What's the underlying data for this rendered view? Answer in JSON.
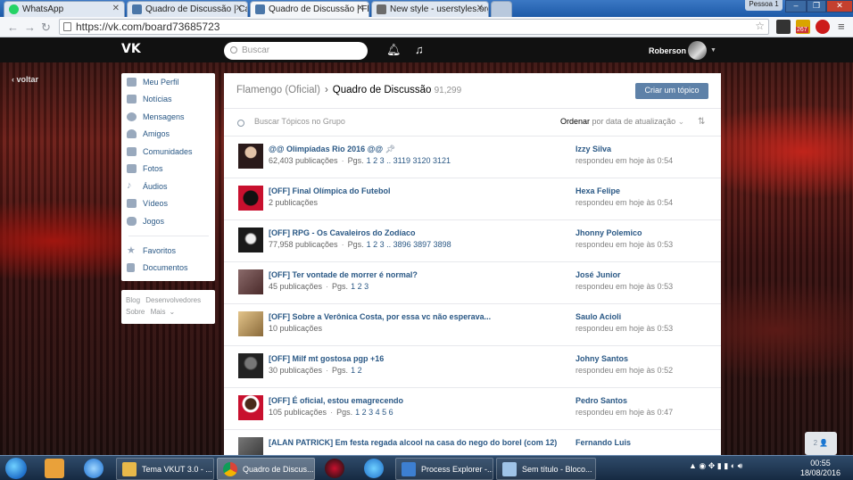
{
  "browser": {
    "tabs": [
      {
        "label": "WhatsApp",
        "icon": "whatsapp-icon",
        "color": "#25d366"
      },
      {
        "label": "Quadro de Discussão | Ca",
        "icon": "vk-icon",
        "color": "#4a76a8"
      },
      {
        "label": "Quadro de Discussão | Fla",
        "icon": "vk-icon",
        "color": "#4a76a8"
      },
      {
        "label": "New style - userstyles.org",
        "icon": "stylish-icon",
        "color": "#6b6b6b"
      }
    ],
    "profile_label": "Pessoa 1",
    "window_controls": [
      "–",
      "❐",
      "✕"
    ],
    "url": "https://vk.com/board73685723",
    "extensions": [
      "star-icon",
      "stylish-ext-icon",
      "gmail-ext-icon",
      "opera-ext-icon",
      "menu-icon"
    ],
    "gmail_badge": "267"
  },
  "vk": {
    "logo": "VK",
    "search_placeholder": "Buscar",
    "user_name": "Roberson",
    "back_link": "voltar"
  },
  "menu": {
    "items": [
      {
        "label": "Meu Perfil",
        "icon": "home-icon"
      },
      {
        "label": "Notícias",
        "icon": "news-icon"
      },
      {
        "label": "Mensagens",
        "icon": "messages-icon"
      },
      {
        "label": "Amigos",
        "icon": "friends-icon"
      },
      {
        "label": "Comunidades",
        "icon": "communities-icon"
      },
      {
        "label": "Fotos",
        "icon": "camera-icon"
      },
      {
        "label": "Áudios",
        "icon": "music-icon"
      },
      {
        "label": "Vídeos",
        "icon": "video-icon"
      },
      {
        "label": "Jogos",
        "icon": "gamepad-icon"
      },
      {
        "label": "Favoritos",
        "icon": "star-icon"
      },
      {
        "label": "Documentos",
        "icon": "document-icon"
      }
    ],
    "footer": [
      "Blog",
      "Desenvolvedores",
      "Sobre",
      "Mais"
    ]
  },
  "board": {
    "breadcrumb_group": "Flamengo (Oficial)",
    "breadcrumb_current": "Quadro de Discussão",
    "topic_count": "91,299",
    "create_button": "Criar um tópico",
    "search_placeholder": "Buscar Tópicos no Grupo",
    "order_label": "Ordenar",
    "order_value": "por data de atualização",
    "topics": [
      {
        "title": "@@ Olimpíadas Rio 2016 @@",
        "count": "62,403 publicações",
        "pages_label": "Pgs.",
        "pages": "1  2  3 .. 3119  3120  3121",
        "author": "Izzy Silva",
        "time": "respondeu em hoje às 0:54",
        "thumb": "#3b2a2a",
        "pinned": true
      },
      {
        "title": "[OFF] Final Olímpica do Futebol",
        "count": "2 publicações",
        "pages_label": "",
        "pages": "",
        "author": "Hexa Felipe",
        "time": "respondeu em hoje às 0:54",
        "thumb": "#c8102e",
        "pinned": false
      },
      {
        "title": "[OFF] RPG - Os Cavaleiros do Zodíaco",
        "count": "77,958 publicações",
        "pages_label": "Pgs.",
        "pages": "1  2  3 .. 3896  3897  3898",
        "author": "Jhonny Polemico",
        "time": "respondeu em hoje às 0:53",
        "thumb": "#1a1a1a",
        "pinned": false
      },
      {
        "title": "[OFF] Ter vontade de morrer é normal?",
        "count": "45 publicações",
        "pages_label": "Pgs.",
        "pages": "1  2  3",
        "author": "José Junior",
        "time": "respondeu em hoje às 0:53",
        "thumb": "#6b4a4a",
        "pinned": false
      },
      {
        "title": "[OFF] Sobre a Verônica Costa, por essa vc não esperava...",
        "count": "10 publicações",
        "pages_label": "",
        "pages": "",
        "author": "Saulo Acioli",
        "time": "respondeu em hoje às 0:53",
        "thumb": "#c9a66b",
        "pinned": false
      },
      {
        "title": "[OFF] Milf mt gostosa pgp +16",
        "count": "30 publicações",
        "pages_label": "Pgs.",
        "pages": "1  2",
        "author": "Johny Santos",
        "time": "respondeu em hoje às 0:52",
        "thumb": "#2b2b2b",
        "pinned": false
      },
      {
        "title": "[OFF] É oficial, estou emagrecendo",
        "count": "105 publicações",
        "pages_label": "Pgs.",
        "pages": "1  2  3  4  5  6",
        "author": "Pedro Santos",
        "time": "respondeu em hoje às 0:47",
        "thumb": "#5a2a2a",
        "pinned": false
      },
      {
        "title": "[ALAN PATRICK] Em festa regada alcool na casa do nego do borel (com 12)",
        "count": "",
        "pages_label": "",
        "pages": "",
        "author": "Fernando Luis",
        "time": "",
        "thumb": "#444444",
        "pinned": false
      }
    ]
  },
  "float_button": "2 👤",
  "taskbar": {
    "tasks": [
      {
        "label": "Tema VKUT 3.0 - ...",
        "icon": "folder-icon",
        "color": "#e8b94a"
      },
      {
        "label": "Quadro de Discus...",
        "icon": "chrome-icon",
        "color": "#4caf50"
      },
      {
        "label": "Process Explorer -...",
        "icon": "process-explorer-icon",
        "color": "#3d7fd1"
      },
      {
        "label": "Sem título - Bloco...",
        "icon": "notepad-icon",
        "color": "#9fc4e8"
      }
    ],
    "time": "00:55",
    "date": "18/08/2016"
  }
}
